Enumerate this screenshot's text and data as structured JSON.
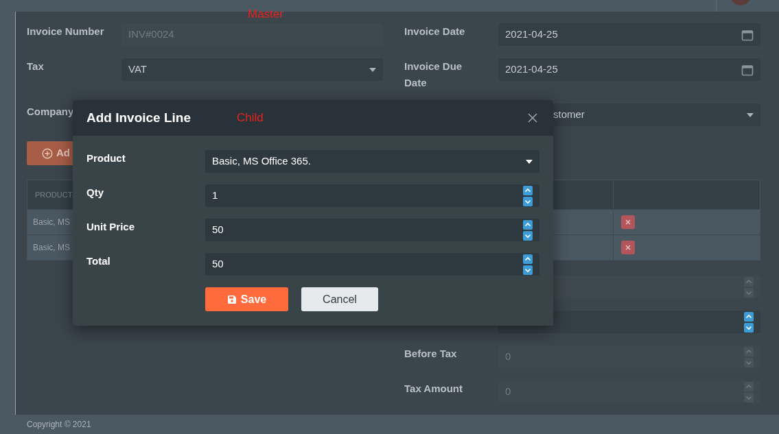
{
  "master_label": "Master",
  "invoice": {
    "rows": [
      [
        {
          "label": "Invoice Number",
          "kind": "text",
          "value": "INV#0024",
          "disabled": true
        },
        {
          "label": "Invoice Date",
          "kind": "date",
          "value": "2021-04-25",
          "disabled": false
        }
      ],
      [
        {
          "label": "Tax",
          "kind": "select",
          "value": "VAT",
          "disabled": false
        },
        {
          "label": "Invoice Due Date",
          "kind": "date",
          "value": "2021-04-25",
          "disabled": false
        }
      ],
      [
        {
          "label": "Company"
        },
        {
          "kind": "select",
          "value": "stomer",
          "disabled": false
        }
      ]
    ],
    "add_button": "Ad",
    "table": {
      "columns": [
        "PRODUCT"
      ],
      "rows": [
        {
          "product": "Basic, MS"
        },
        {
          "product": "Basic, MS"
        }
      ]
    },
    "totals": [
      {
        "kind": "number",
        "disabled": true
      },
      {
        "kind": "number",
        "disabled": false
      },
      {
        "label": "Before Tax",
        "kind": "number",
        "value": "0",
        "disabled": true
      },
      {
        "label": "Tax Amount",
        "kind": "number",
        "value": "0",
        "disabled": true
      }
    ]
  },
  "dialog": {
    "title": "Add Invoice Line",
    "note": "Child",
    "fields": [
      {
        "label": "Product",
        "kind": "select",
        "value": "Basic, MS Office 365."
      },
      {
        "label": "Qty",
        "kind": "number",
        "value": "1"
      },
      {
        "label": "Unit Price",
        "kind": "number",
        "value": "50"
      },
      {
        "label": "Total",
        "kind": "number",
        "value": "50"
      }
    ],
    "buttons": [
      {
        "label": "Save",
        "kind": "primary"
      },
      {
        "label": "Cancel",
        "kind": "secondary"
      }
    ]
  },
  "footer": "Copyright © 2021"
}
